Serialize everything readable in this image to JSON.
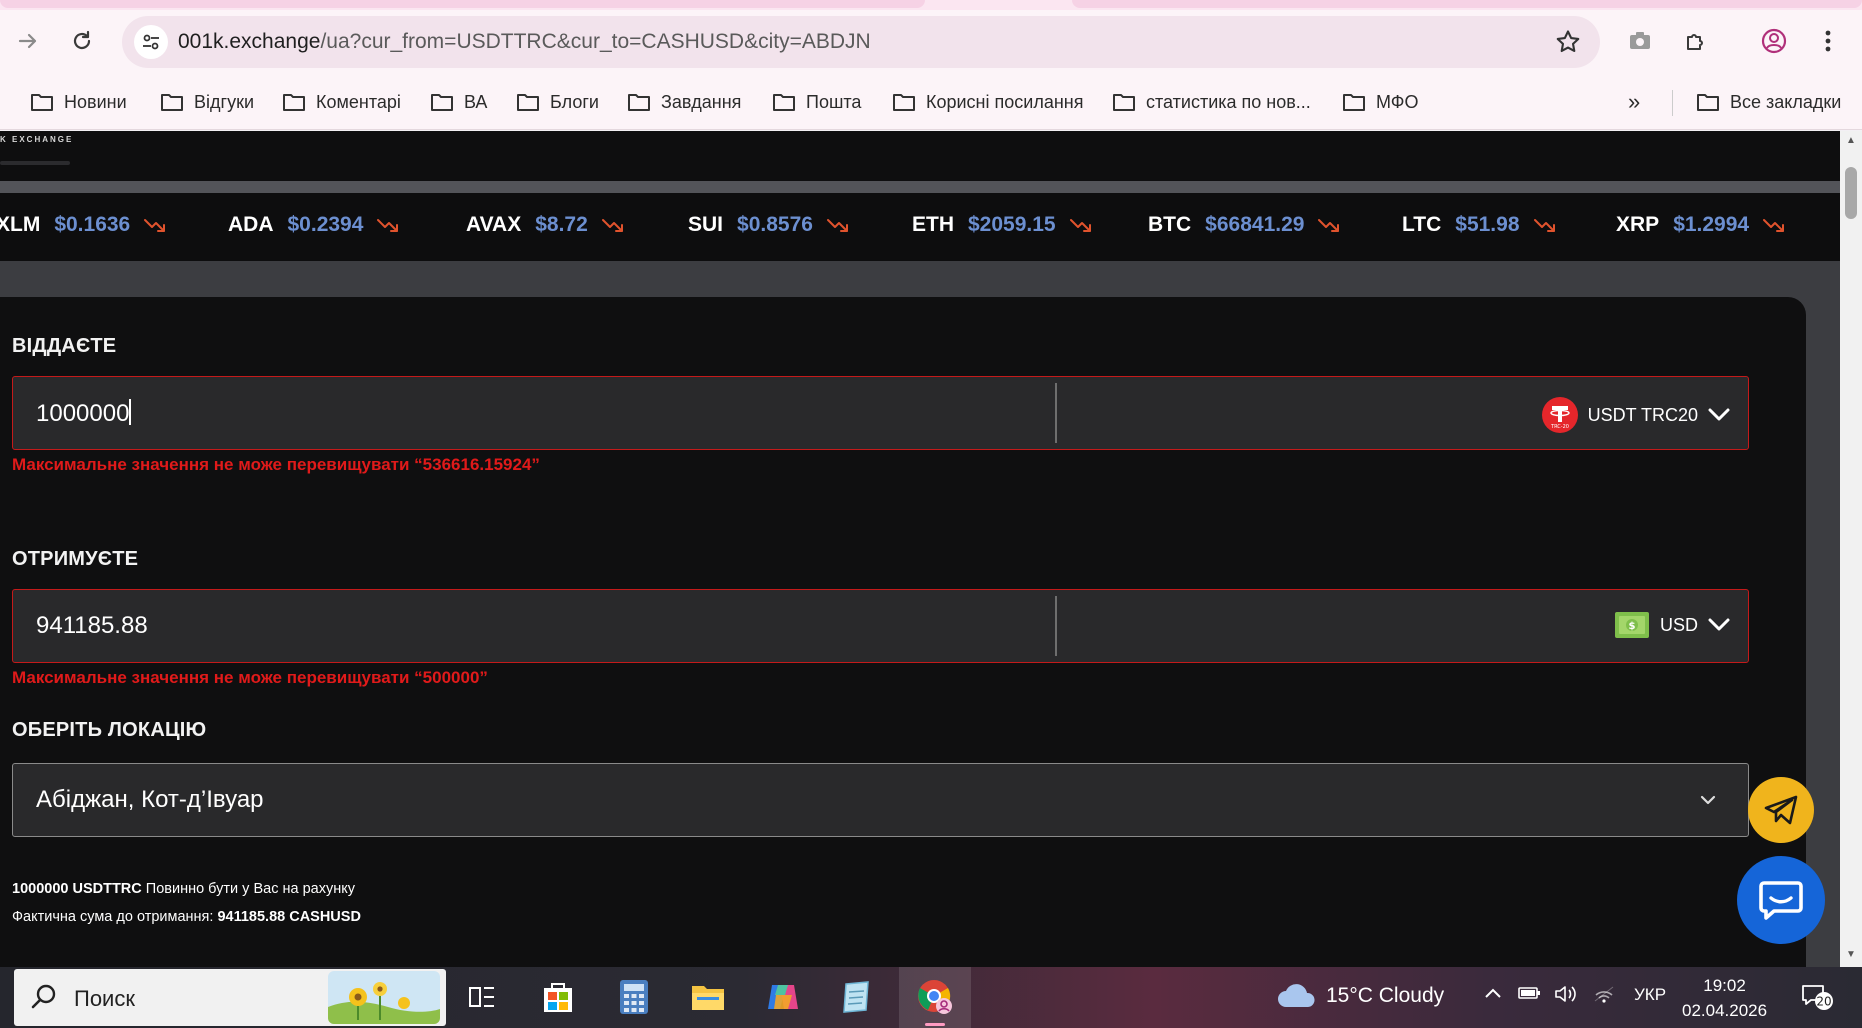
{
  "browser": {
    "url_host": "001k.exchange",
    "url_path": "/ua?cur_from=USDTTRC&cur_to=CASHUSD&city=ABDJN",
    "bookmarks": [
      "Новини",
      "Відгуки",
      "Коментарі",
      "ВА",
      "Блоги",
      "Завдання",
      "Пошта",
      "Корисні посилання",
      "статистика по нов...",
      "МФО"
    ],
    "more_label": "»",
    "all_bookmarks": "Все закладки"
  },
  "site": {
    "logo_text": "K EXCHANGE",
    "ticker": [
      {
        "symbol": "XLM",
        "price": "$0.1636"
      },
      {
        "symbol": "ADA",
        "price": "$0.2394"
      },
      {
        "symbol": "AVAX",
        "price": "$8.72"
      },
      {
        "symbol": "SUI",
        "price": "$0.8576"
      },
      {
        "symbol": "ETH",
        "price": "$2059.15"
      },
      {
        "symbol": "BTC",
        "price": "$66841.29"
      },
      {
        "symbol": "LTC",
        "price": "$51.98"
      },
      {
        "symbol": "XRP",
        "price": "$1.2994"
      }
    ]
  },
  "exchange": {
    "give_label": "ВІДДАЄТЕ",
    "give_value": "1000000",
    "give_currency": "USDT TRC20",
    "give_currency_icon_text": "TRC-20",
    "give_error": "Максимальне значення не може перевищувати “536616.15924”",
    "receive_label": "ОТРИМУЄТЕ",
    "receive_value": "941185.88",
    "receive_currency": "USD",
    "receive_error": "Максимальне значення не може перевищувати “500000”",
    "location_label": "ОБЕРІТЬ ЛОКАЦІЮ",
    "location_value": "Абіджан, Кот-д’Івуар",
    "summary_amount": "1000000 USDTTRC",
    "summary_line1_rest": " Повинно бути у Вас на рахунку",
    "summary_line2_prefix": "Фактична сума до отримання: ",
    "summary_receive": "941185.88 CASHUSD"
  },
  "taskbar": {
    "search_text": "Поиск",
    "weather": "15°C  Cloudy",
    "language": "УКР",
    "time": "19:02",
    "date": "02.04.2026",
    "notifications": "20"
  },
  "colors": {
    "accent_blue": "#6c8fd0",
    "error_red": "#e01a1a",
    "arrow_down": "#e0532d",
    "telegram_yellow": "#f0b41c",
    "chat_blue": "#1565d8"
  }
}
